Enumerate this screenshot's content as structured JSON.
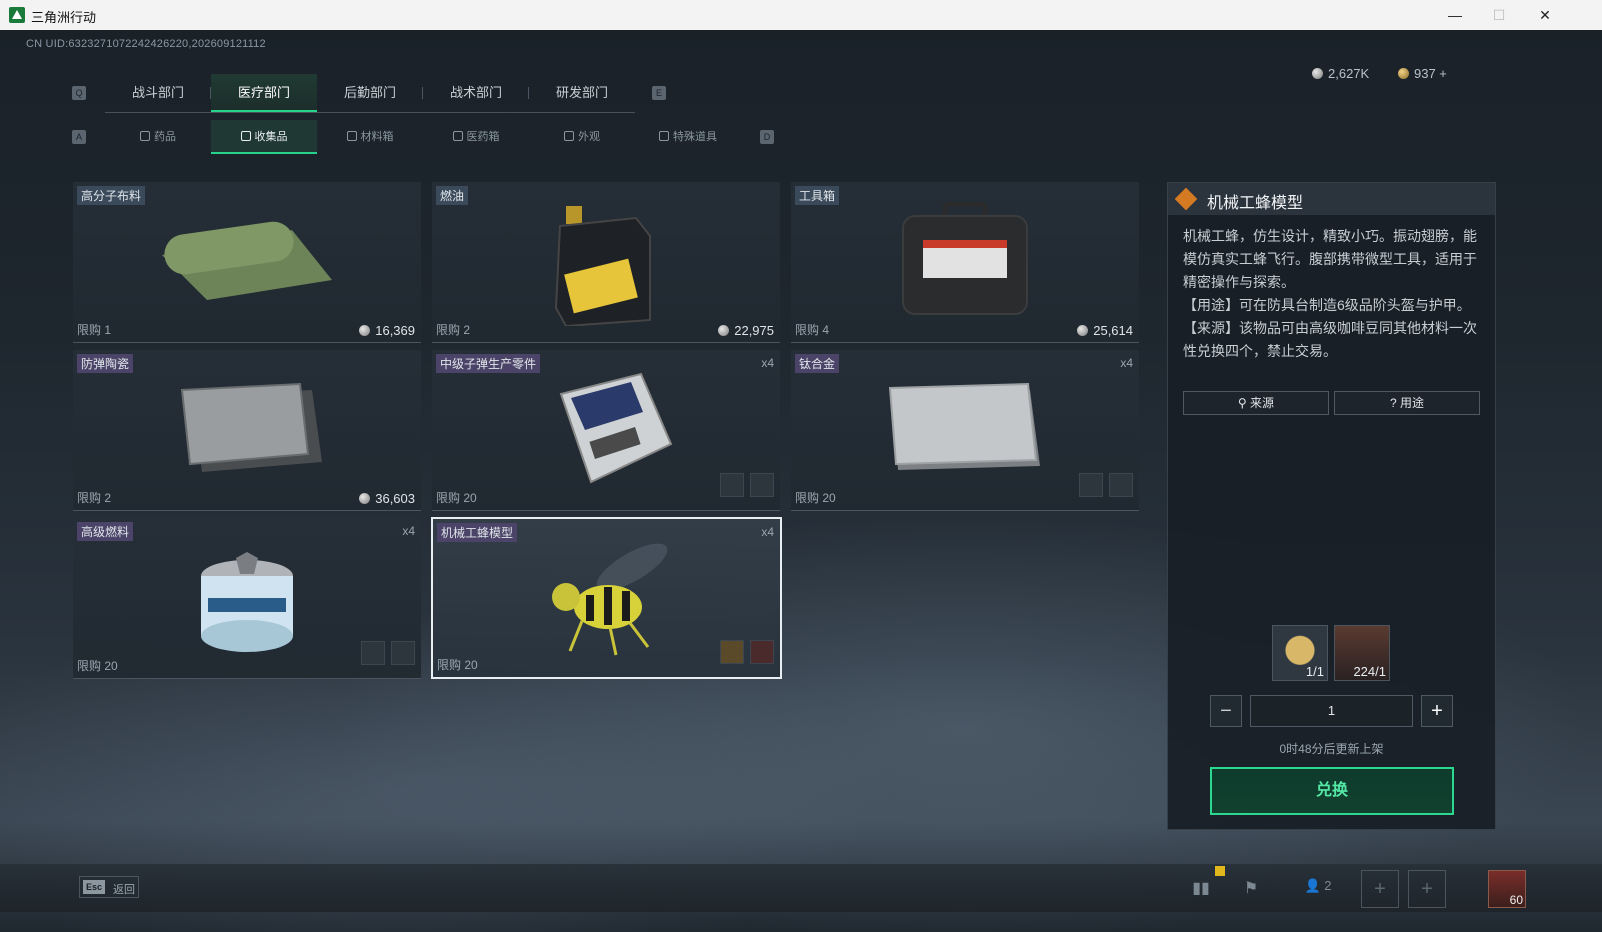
{
  "window": {
    "title": "三角洲行动",
    "minimize": "—",
    "maximize": "☐",
    "close": "✕"
  },
  "uid": "CN UID:6323271072242426220,202609121112",
  "currency": {
    "silver": "2,627K",
    "gold": "937 +"
  },
  "tabs": [
    {
      "label": "战斗部门"
    },
    {
      "label": "医疗部门",
      "active": true
    },
    {
      "label": "后勤部门"
    },
    {
      "label": "战术部门"
    },
    {
      "label": "研发部门"
    }
  ],
  "tab_keys": {
    "left": "Q",
    "right": "E"
  },
  "subtabs": [
    {
      "label": "药品"
    },
    {
      "label": "收集品",
      "active": true
    },
    {
      "label": "材料箱"
    },
    {
      "label": "医药箱"
    },
    {
      "label": "外观"
    },
    {
      "label": "特殊道具"
    }
  ],
  "subtab_keys": {
    "left": "A",
    "right": "D"
  },
  "items": [
    {
      "name": "高分子布料",
      "limit": "限购 1",
      "price": "16,369",
      "mult": "",
      "tag": "blue"
    },
    {
      "name": "燃油",
      "limit": "限购 2",
      "price": "22,975",
      "mult": "",
      "tag": "blue"
    },
    {
      "name": "工具箱",
      "limit": "限购 4",
      "price": "25,614",
      "mult": "",
      "tag": "blue"
    },
    {
      "name": "防弹陶瓷",
      "limit": "限购 2",
      "price": "36,603",
      "mult": "",
      "tag": "purple"
    },
    {
      "name": "中级子弹生产零件",
      "limit": "限购 20",
      "price": "",
      "mult": "x4",
      "tag": "purple"
    },
    {
      "name": "钛合金",
      "limit": "限购 20",
      "price": "",
      "mult": "x4",
      "tag": "purple"
    },
    {
      "name": "高级燃料",
      "limit": "限购 20",
      "price": "",
      "mult": "x4",
      "tag": "purple"
    },
    {
      "name": "机械工蜂模型",
      "limit": "限购 20",
      "price": "",
      "mult": "x4",
      "tag": "purple",
      "selected": true
    }
  ],
  "detail": {
    "title": "机械工蜂模型",
    "desc1": "机械工蜂，仿生设计，精致小巧。振动翅膀，能模仿真实工蜂飞行。腹部携带微型工具，适用于精密操作与探索。",
    "desc2": "【用途】可在防具台制造6级品阶头盔与护甲。",
    "desc3": "【来源】该物品可由高级咖啡豆同其他材料一次性兑换四个，禁止交易。",
    "source_btn": "来源",
    "use_btn": "用途",
    "req1_count": "1/1",
    "req2_count": "224/1",
    "quantity": "1",
    "restock": "0时48分后更新上架",
    "exchange_btn": "兑换"
  },
  "bottom": {
    "esc_key": "Esc",
    "esc_label": "返回",
    "friends_count": "2",
    "level": "60"
  },
  "colors": {
    "accent": "#27d38a",
    "tag_blue": "#3b4a5a",
    "tag_purple": "#4c4468"
  }
}
